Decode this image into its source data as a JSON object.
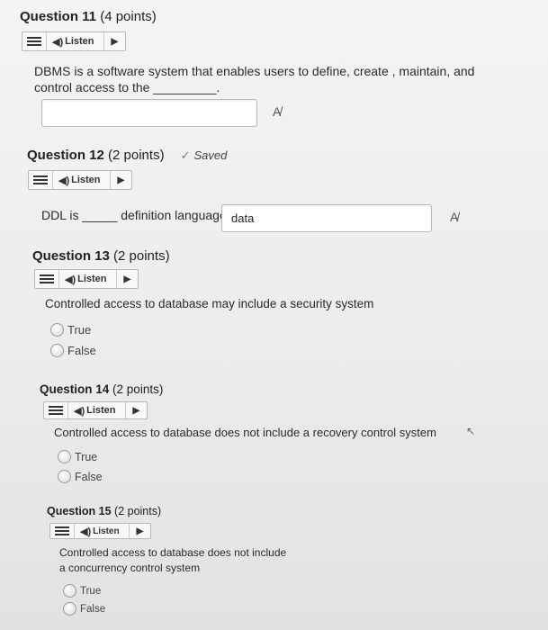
{
  "listen_label": "Listen",
  "q11": {
    "number": "Question 11",
    "points": "(4 points)",
    "prompt_line1": "DBMS is a  software system that enables users to define, create , maintain, and",
    "prompt_line2": "control access to the _________.",
    "answer": ""
  },
  "q12": {
    "number": "Question 12",
    "points": "(2 points)",
    "saved": "Saved",
    "prompt": "DDL is _____ definition language",
    "answer": "data"
  },
  "q13": {
    "number": "Question 13",
    "points": "(2 points)",
    "prompt": "Controlled access to database may include a security system",
    "options": [
      "True",
      "False"
    ]
  },
  "q14": {
    "number": "Question 14",
    "points": "(2 points)",
    "prompt": "Controlled access to database does not include a recovery control system",
    "options": [
      "True",
      "False"
    ]
  },
  "q15": {
    "number": "Question 15",
    "points": "(2 points)",
    "prompt_line1": "Controlled access to database does not include",
    "prompt_line2": "a concurrency control system",
    "options": [
      "True",
      "False"
    ]
  }
}
